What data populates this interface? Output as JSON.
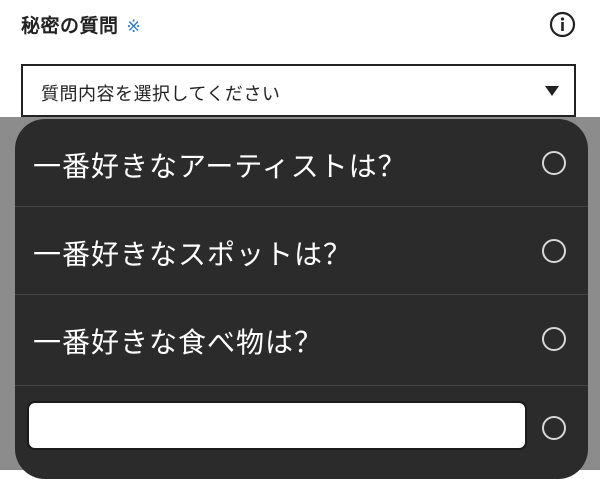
{
  "field": {
    "label": "秘密の質問",
    "required_mark": "※"
  },
  "select": {
    "placeholder": "質問内容を選択してください"
  },
  "options": [
    {
      "label": "一番好きなアーティストは？"
    },
    {
      "label": "一番好きなスポットは？"
    },
    {
      "label": "一番好きな食べ物は？"
    }
  ],
  "custom_option": {
    "value": ""
  },
  "colors": {
    "sheet_bg": "#2b2b2b",
    "overlay": "#8c8c8c",
    "accent": "#2a7fd8"
  }
}
